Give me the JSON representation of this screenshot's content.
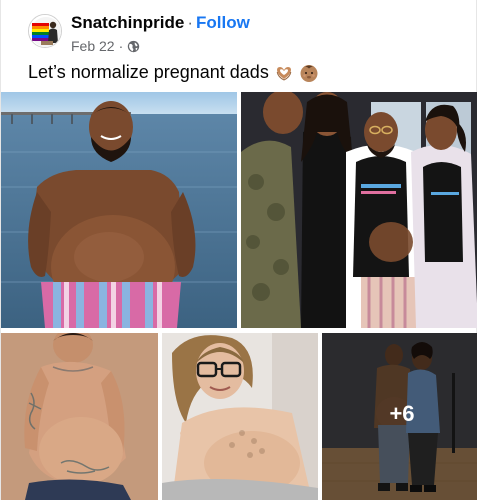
{
  "post": {
    "author": "Snatchinpride",
    "separator": "·",
    "follow_label": "Follow",
    "date": "Feb 22",
    "date_separator": "·",
    "privacy_icon": "globe-icon",
    "text": "Let’s normalize pregnant dads",
    "emojis": [
      "heart-hands-emoji",
      "baby-emoji"
    ]
  },
  "photos": {
    "count": 5,
    "more_overlay_label": "+6"
  },
  "colors": {
    "link": "#1877f2",
    "secondary_text": "#65676b",
    "primary_text": "#050505"
  }
}
